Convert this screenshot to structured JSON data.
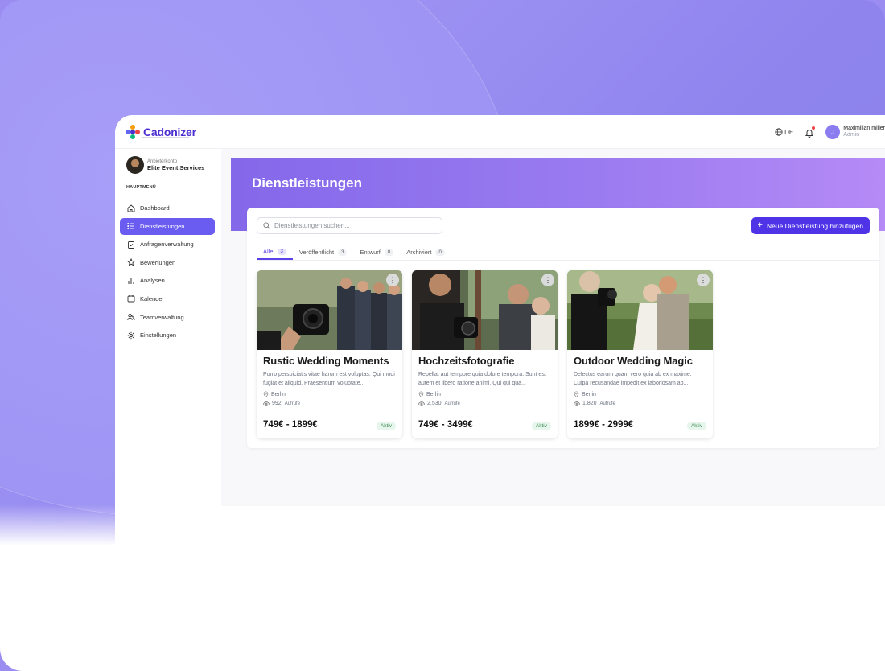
{
  "brand": {
    "name": "Cadonizer",
    "accent": "#4f33e6",
    "primary": "#6a5cf0"
  },
  "header": {
    "language": "DE",
    "user": {
      "initial": "J",
      "name": "Maximilian miller",
      "role": "Admin"
    }
  },
  "sidebar": {
    "account_label": "Anbieterkonto",
    "account_name": "Elite Event Services",
    "section_title": "HAUPTMENÜ",
    "items": [
      {
        "label": "Dashboard",
        "icon": "home-icon",
        "active": false
      },
      {
        "label": "Dienstleistungen",
        "icon": "list-icon",
        "active": true
      },
      {
        "label": "Anfragenverwaltung",
        "icon": "clipboard-icon",
        "active": false
      },
      {
        "label": "Bewertungen",
        "icon": "star-icon",
        "active": false
      },
      {
        "label": "Analysen",
        "icon": "bar-chart-icon",
        "active": false
      },
      {
        "label": "Kalender",
        "icon": "calendar-icon",
        "active": false
      },
      {
        "label": "Teamverwaltung",
        "icon": "users-icon",
        "active": false
      },
      {
        "label": "Einstellungen",
        "icon": "gear-icon",
        "active": false
      }
    ]
  },
  "page": {
    "title": "Dienstleistungen",
    "search_placeholder": "Dienstleistungen suchen...",
    "add_button": "Neue Dienstleistung hinzufügen",
    "tabs": [
      {
        "label": "Alle",
        "count": "3"
      },
      {
        "label": "Veröffentlicht",
        "count": "3"
      },
      {
        "label": "Entwurf",
        "count": "0"
      },
      {
        "label": "Archiviert",
        "count": "0"
      }
    ]
  },
  "services": [
    {
      "title": "Rustic Wedding Moments",
      "description": "Porro perspiciatis vitae harum est voluptas. Qui modi fugiat et aliquid. Praesentium voluptate...",
      "location": "Berlin",
      "views": "992",
      "views_label": "Aufrufe",
      "price": "749€ - 1899€",
      "status": "Aktiv"
    },
    {
      "title": "Hochzeitsfotografie",
      "description": "Repellat aut tempore quia dolore tempora. Sunt est autem et libero ratione animi. Qui qui qua...",
      "location": "Berlin",
      "views": "2,530",
      "views_label": "Aufrufe",
      "price": "749€ - 3499€",
      "status": "Aktiv"
    },
    {
      "title": "Outdoor Wedding Magic",
      "description": "Delectus earum quam vero quia ab ex maxime. Culpa recusandae impedit ex laboriosam ab...",
      "location": "Berlin",
      "views": "1,820",
      "views_label": "Aufrufe",
      "price": "1899€ - 2999€",
      "status": "Aktiv"
    }
  ]
}
